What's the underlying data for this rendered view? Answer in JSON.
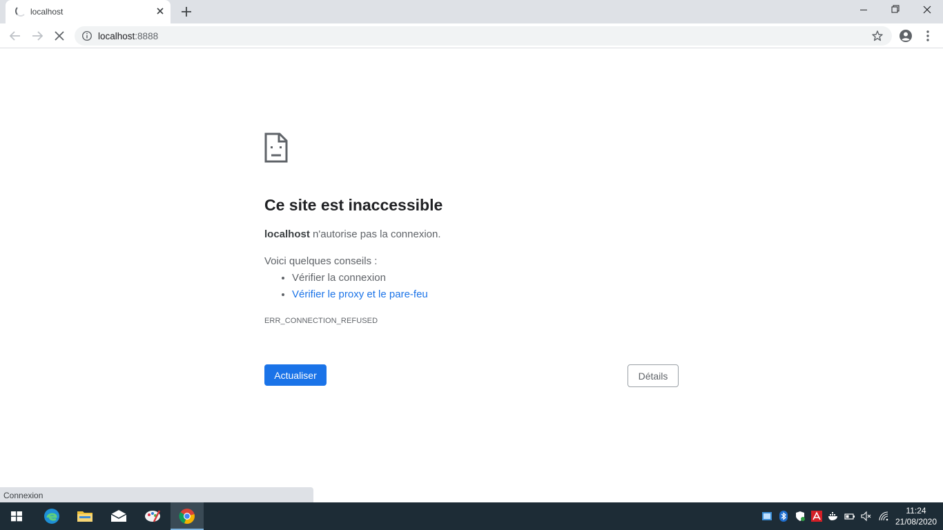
{
  "browser": {
    "tab": {
      "title": "localhost"
    },
    "address": {
      "host": "localhost",
      "port": ":8888"
    }
  },
  "page": {
    "heading": "Ce site est inaccessible",
    "desc_host": "localhost",
    "desc_rest": " n'autorise pas la connexion.",
    "tips_title": "Voici quelques conseils :",
    "tips": [
      "Vérifier la connexion",
      "Vérifier le proxy et le pare-feu"
    ],
    "error_code": "ERR_CONNECTION_REFUSED",
    "reload_label": "Actualiser",
    "details_label": "Détails"
  },
  "status": {
    "text": "Connexion"
  },
  "taskbar": {
    "apps": [
      "windows-start",
      "edge",
      "file-explorer",
      "mail",
      "paint",
      "chrome"
    ],
    "clock": {
      "time": "11:24",
      "date": "21/08/2020"
    }
  },
  "colors": {
    "accent": "#1a73e8",
    "taskbar": "#1d2c36"
  }
}
